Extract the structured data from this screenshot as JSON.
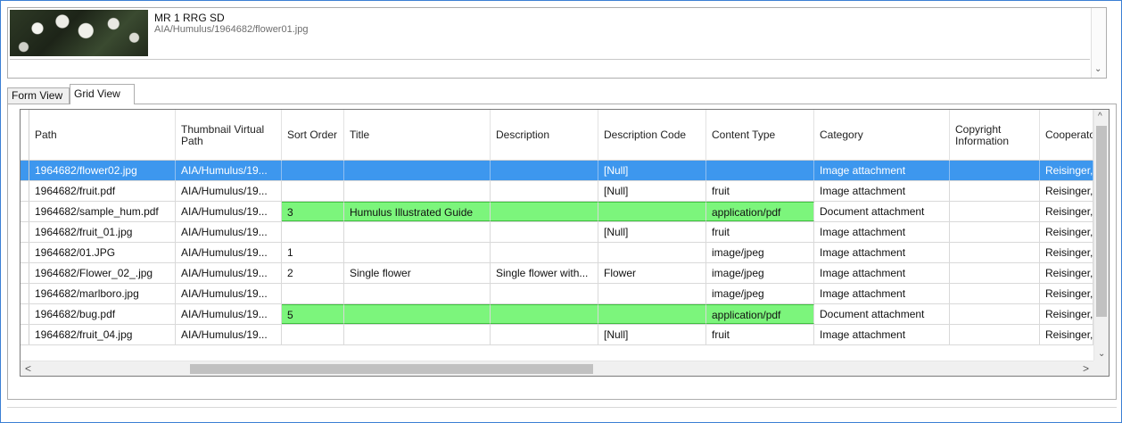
{
  "preview": {
    "title": "MR 1 RRG SD",
    "path": "AIA/Humulus/1964682/flower01.jpg",
    "scroll_down_glyph": "⌄"
  },
  "tabs": [
    {
      "label": "Form View",
      "active": false
    },
    {
      "label": "Grid View",
      "active": true
    }
  ],
  "grid": {
    "columns": [
      {
        "key": "path",
        "label": "Path"
      },
      {
        "key": "thumb",
        "label": "Thumbnail Virtual Path"
      },
      {
        "key": "sort",
        "label": "Sort Order"
      },
      {
        "key": "title",
        "label": "Title"
      },
      {
        "key": "desc",
        "label": "Description"
      },
      {
        "key": "desc_code",
        "label": "Description Code"
      },
      {
        "key": "content_type",
        "label": "Content Type"
      },
      {
        "key": "category",
        "label": "Category"
      },
      {
        "key": "copyright",
        "label": "Copyright Information"
      },
      {
        "key": "coop",
        "label": "Cooperato"
      }
    ],
    "rows": [
      {
        "selected": true,
        "green": false,
        "cells": [
          "1964682/flower02.jpg",
          "AIA/Humulus/19...",
          "",
          "",
          "",
          "[Null]",
          "",
          "Image attachment",
          "",
          "Reisinger,"
        ]
      },
      {
        "selected": false,
        "green": false,
        "cells": [
          "1964682/fruit.pdf",
          "AIA/Humulus/19...",
          "",
          "",
          "",
          "[Null]",
          "fruit",
          "Image attachment",
          "",
          "Reisinger,"
        ]
      },
      {
        "selected": false,
        "green": true,
        "cells": [
          "1964682/sample_hum.pdf",
          "AIA/Humulus/19...",
          "3",
          "Humulus Illustrated Guide",
          "",
          "",
          "application/pdf",
          "Document attachment",
          "",
          "Reisinger,"
        ]
      },
      {
        "selected": false,
        "green": false,
        "cells": [
          "1964682/fruit_01.jpg",
          "AIA/Humulus/19...",
          "",
          "",
          "",
          "[Null]",
          "fruit",
          "Image attachment",
          "",
          "Reisinger,"
        ]
      },
      {
        "selected": false,
        "green": false,
        "cells": [
          "1964682/01.JPG",
          "AIA/Humulus/19...",
          "1",
          "",
          "",
          "",
          "image/jpeg",
          "Image attachment",
          "",
          "Reisinger,"
        ]
      },
      {
        "selected": false,
        "green": false,
        "cells": [
          "1964682/Flower_02_.jpg",
          "AIA/Humulus/19...",
          "2",
          "Single flower",
          "Single flower with...",
          "Flower",
          "image/jpeg",
          "Image attachment",
          "",
          "Reisinger,"
        ]
      },
      {
        "selected": false,
        "green": false,
        "cells": [
          "1964682/marlboro.jpg",
          "AIA/Humulus/19...",
          "",
          "",
          "",
          "",
          "image/jpeg",
          "Image attachment",
          "",
          "Reisinger,"
        ]
      },
      {
        "selected": false,
        "green": true,
        "cells": [
          "1964682/bug.pdf",
          "AIA/Humulus/19...",
          "5",
          "",
          "",
          "",
          "application/pdf",
          "Document attachment",
          "",
          "Reisinger,"
        ]
      },
      {
        "selected": false,
        "green": false,
        "cells": [
          "1964682/fruit_04.jpg",
          "AIA/Humulus/19...",
          "",
          "",
          "",
          "[Null]",
          "fruit",
          "Image attachment",
          "",
          "Reisinger,"
        ]
      }
    ],
    "scroll": {
      "up": "^",
      "down": "⌄",
      "left": "<",
      "right": ">"
    }
  },
  "colors": {
    "selected_row": "#3d97ee",
    "green_cells": "#7cf57c",
    "frame_border": "#3b7fd4"
  },
  "icons": {
    "thumbnail": "flower-thumbnail-image"
  }
}
